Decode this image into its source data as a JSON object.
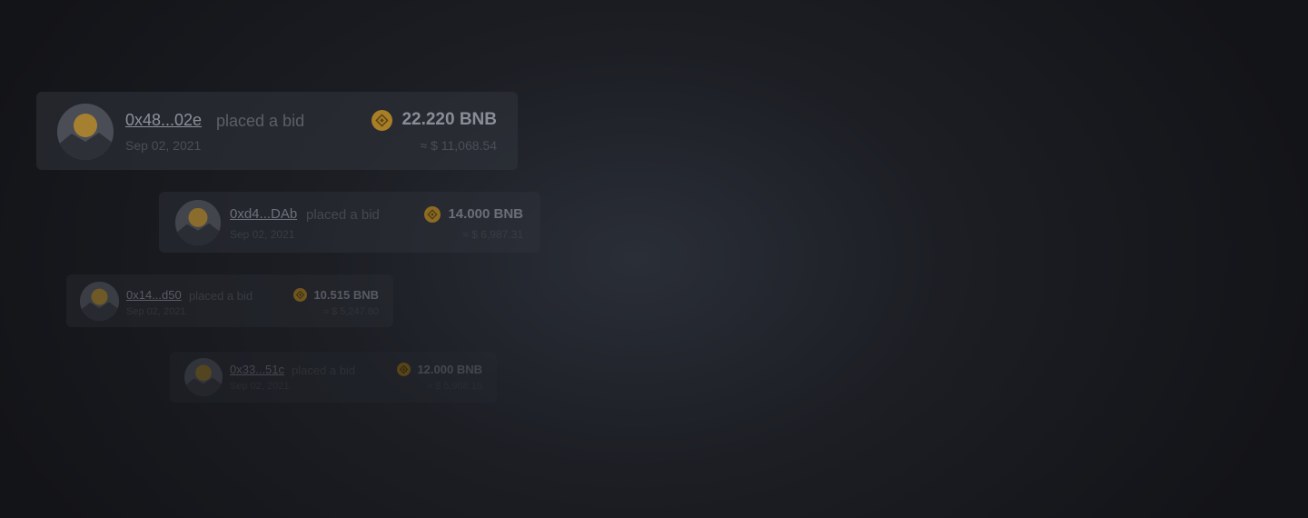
{
  "colors": {
    "background": "#1c1e24",
    "coin": "#c8982c",
    "avatar_sun": "#c8982c"
  },
  "bids": [
    {
      "address": "0x48...02e",
      "action": "placed a bid",
      "date": "Sep 02, 2021",
      "amount": "22.220 BNB",
      "usd": "≈ $ 11,068.54",
      "avatar_icon": "avatar-placeholder-icon",
      "coin_icon": "bnb-coin-icon"
    },
    {
      "address": "0xd4...DAb",
      "action": "placed a bid",
      "date": "Sep 02, 2021",
      "amount": "14.000 BNB",
      "usd": "≈ $ 6,987.31",
      "avatar_icon": "avatar-placeholder-icon",
      "coin_icon": "bnb-coin-icon"
    },
    {
      "address": "0x14...d50",
      "action": "placed a bid",
      "date": "Sep 02, 2021",
      "amount": "10.515 BNB",
      "usd": "≈ $ 5,247.80",
      "avatar_icon": "avatar-placeholder-icon",
      "coin_icon": "bnb-coin-icon"
    },
    {
      "address": "0x33...51c",
      "action": "placed a bid",
      "date": "Sep 02, 2021",
      "amount": "12.000 BNB",
      "usd": "≈ $ 5,988.16",
      "avatar_icon": "avatar-placeholder-icon",
      "coin_icon": "bnb-coin-icon"
    }
  ]
}
